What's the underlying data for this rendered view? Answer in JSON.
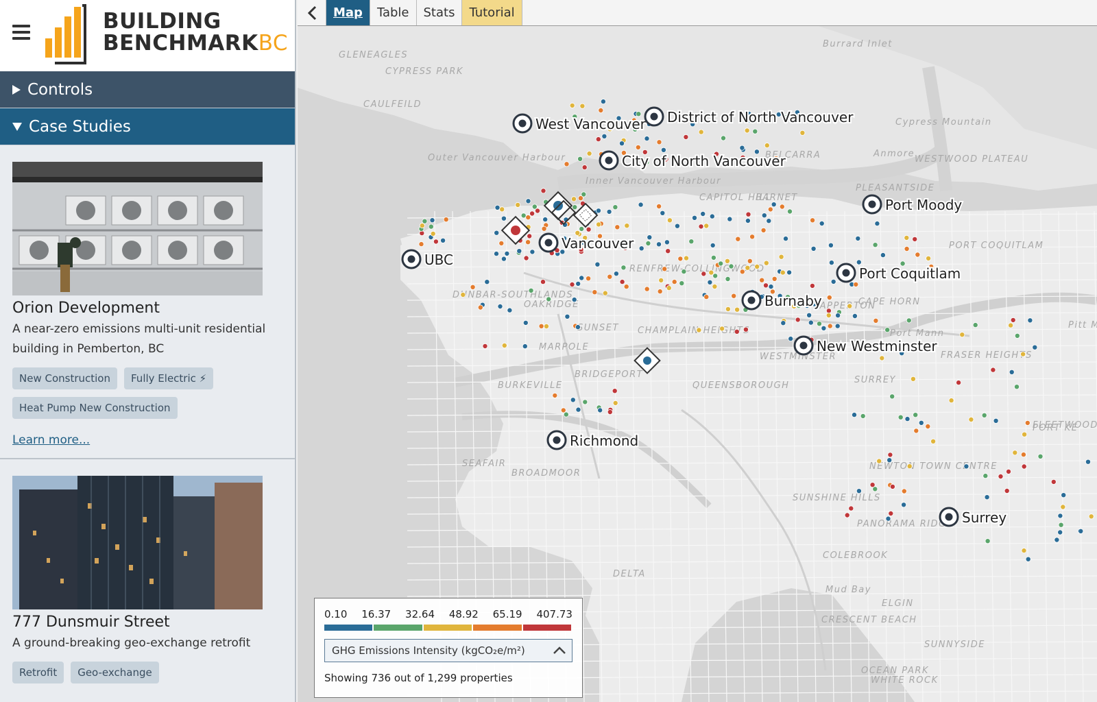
{
  "brand": {
    "line1": "BUILDING",
    "line2": "BENCHMARK",
    "suffix": "BC",
    "accent": "#f5a41b"
  },
  "sidebar": {
    "controls_label": "Controls",
    "case_studies_label": "Case Studies",
    "cases": [
      {
        "title": "Orion Development",
        "description": "A near-zero emissions multi-unit residential building in Pemberton, BC",
        "tags": [
          "New Construction",
          "Fully Electric ⚡",
          "Heat Pump New Construction"
        ],
        "learn_more": "Learn more..."
      },
      {
        "title": "777 Dunsmuir Street",
        "description": "A ground-breaking geo-exchange retrofit",
        "tags": [
          "Retrofit",
          "Geo-exchange"
        ]
      }
    ]
  },
  "tabs": {
    "back_icon": "chevron-left-icon",
    "items": [
      "Map",
      "Table",
      "Stats",
      "Tutorial"
    ]
  },
  "map": {
    "cities": [
      "West Vancouver",
      "District of North Vancouver",
      "City of North Vancouver",
      "Port Moody",
      "UBC",
      "Vancouver",
      "Port Coquitlam",
      "Burnaby",
      "New Westminster",
      "Richmond",
      "Surrey"
    ],
    "neighbourhoods": [
      "GLENEAGLES",
      "CYPRESS PARK",
      "CAULFEILD",
      "Burrard Inlet",
      "Cypress Mountain",
      "Outer Vancouver Harbour",
      "Inner Vancouver Harbour",
      "BELCARRA",
      "Anmore",
      "WESTWOOD PLATEAU",
      "PLEASANTSIDE",
      "PORT COQUITLAM",
      "BARNET",
      "CAPITOL HILL",
      "RENFREW-COLLINGWOOD",
      "DUNBAR-SOUTHLANDS",
      "OAKRIDGE",
      "SUNSET",
      "MARPOLE",
      "CHAMPLAIN HEIGHTS",
      "BURKEVILLE",
      "BRIDGEPORT",
      "QUEENSBOROUGH",
      "SAPPERTON",
      "CAPE HORN",
      "WESTMINSTER",
      "FRASER HEIGHTS",
      "SURREY",
      "Port Mann",
      "Pitt M",
      "FLEETWOOD TOWN CENTRE",
      "PORT KE",
      "NEWTON TOWN CENTRE",
      "SEAFAIR",
      "BROADMOOR",
      "SUNSHINE HILLS",
      "PANORAMA RIDGE",
      "COLEBROOK",
      "DELTA",
      "Mud Bay",
      "ELGIN",
      "CRESCENT BEACH",
      "SUNNYSIDE",
      "OCEAN PARK",
      "WHITE ROCK"
    ],
    "colors": {
      "water": "#d3d3d3",
      "land": "#ececec",
      "blue": "#2a6c97",
      "green": "#5aa56b",
      "yellow": "#e0b53c",
      "orange": "#e47c2e",
      "red": "#c0373a"
    }
  },
  "legend": {
    "ticks": [
      "0.10",
      "16.37",
      "32.64",
      "48.92",
      "65.19",
      "407.73"
    ],
    "colors": [
      "#2a6c97",
      "#5aa56b",
      "#e0b53c",
      "#e47c2e",
      "#c0373a"
    ],
    "metric": "GHG Emissions Intensity (kgCO₂e/m²)",
    "showing": "Showing 736 out of 1,299 properties"
  }
}
